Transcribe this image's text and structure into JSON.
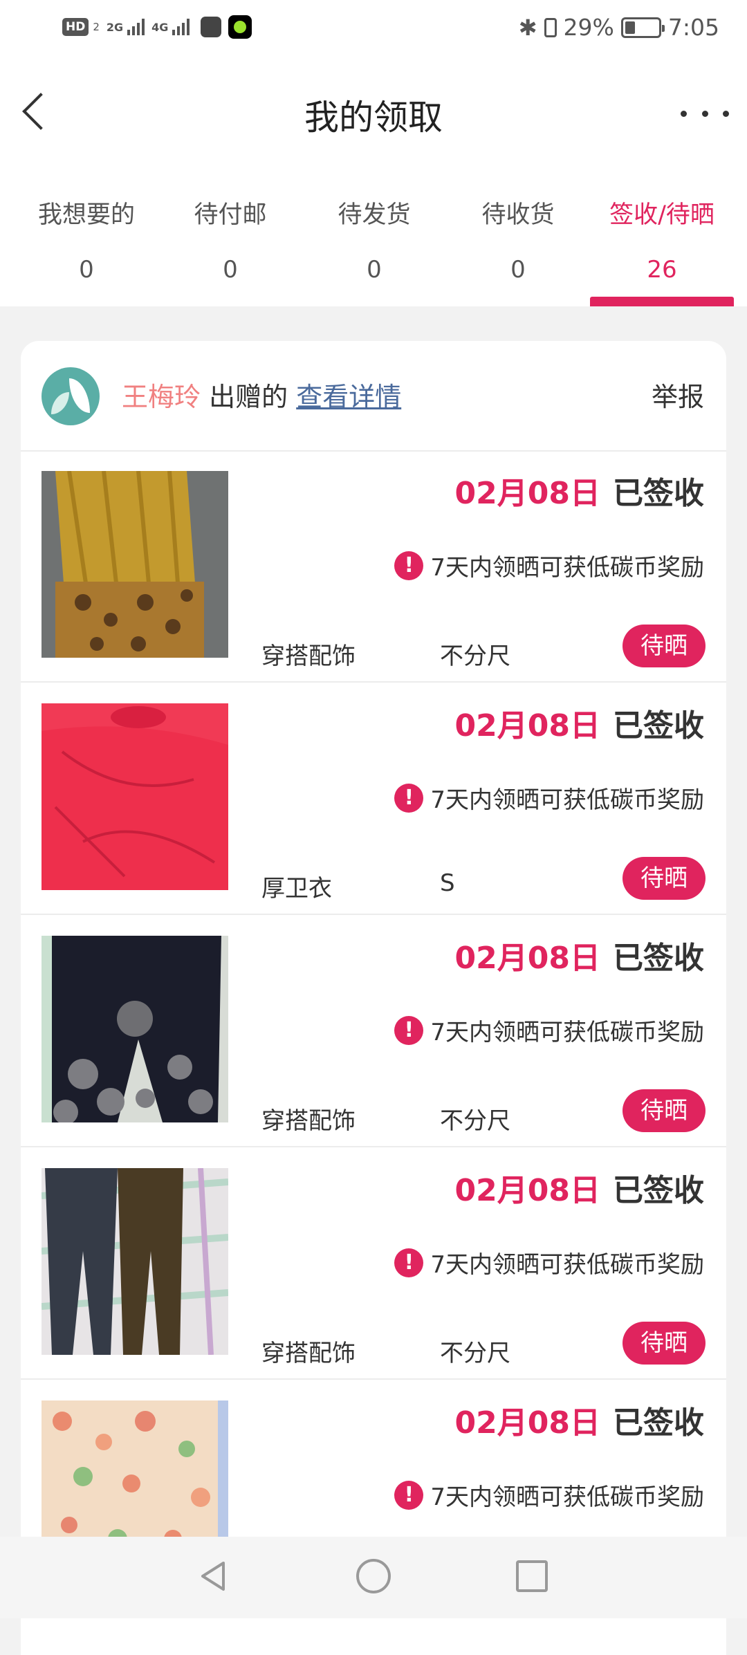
{
  "status_bar": {
    "network": "HD",
    "network_sub": "2",
    "signal1": "2G",
    "signal2": "4G",
    "battery_percent": "29%",
    "time": "7:05"
  },
  "header": {
    "title": "我的领取"
  },
  "tabs": [
    {
      "label": "我想要的",
      "count": "0"
    },
    {
      "label": "待付邮",
      "count": "0"
    },
    {
      "label": "待发货",
      "count": "0"
    },
    {
      "label": "待收货",
      "count": "0"
    },
    {
      "label": "签收/待晒",
      "count": "26"
    }
  ],
  "card": {
    "donor_name": "王梅玲",
    "donated_text": " 出赠的 ",
    "view_detail": "查看详情",
    "report": "举报"
  },
  "items": [
    {
      "date": "02月08日",
      "status": "已签收",
      "reward": "7天内领晒可获低碳币奖励",
      "category": "穿搭配饰",
      "size": "不分尺",
      "action": "待晒"
    },
    {
      "date": "02月08日",
      "status": "已签收",
      "reward": "7天内领晒可获低碳币奖励",
      "category": "厚卫衣",
      "size": "S",
      "action": "待晒"
    },
    {
      "date": "02月08日",
      "status": "已签收",
      "reward": "7天内领晒可获低碳币奖励",
      "category": "穿搭配饰",
      "size": "不分尺",
      "action": "待晒"
    },
    {
      "date": "02月08日",
      "status": "已签收",
      "reward": "7天内领晒可获低碳币奖励",
      "category": "穿搭配饰",
      "size": "不分尺",
      "action": "待晒"
    },
    {
      "date": "02月08日",
      "status": "已签收",
      "reward": "7天内领晒可获低碳币奖励"
    }
  ],
  "colors": {
    "accent": "#e0245e",
    "donor_name": "#f08080",
    "link": "#4a6a9c"
  }
}
